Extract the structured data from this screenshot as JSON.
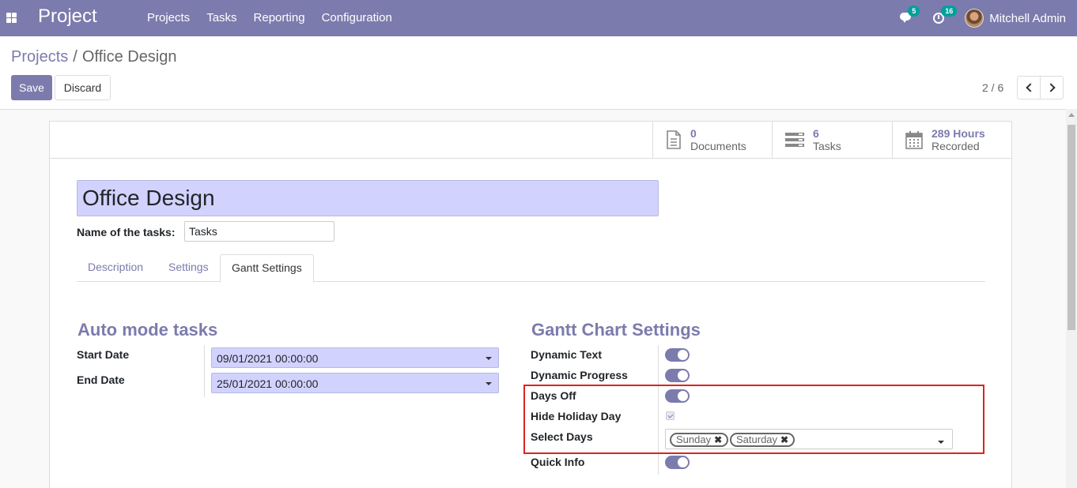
{
  "navbar": {
    "brand": "Project",
    "menu": [
      "Projects",
      "Tasks",
      "Reporting",
      "Configuration"
    ],
    "messages_count": "5",
    "activities_count": "16",
    "user_name": "Mitchell Admin"
  },
  "breadcrumb": {
    "parent": "Projects",
    "separator": "/",
    "current": "Office Design"
  },
  "actions": {
    "save": "Save",
    "discard": "Discard"
  },
  "pager": {
    "value": "2 / 6"
  },
  "stats": [
    {
      "value": "0",
      "label": "Documents",
      "icon": "document-icon"
    },
    {
      "value": "6",
      "label": "Tasks",
      "icon": "tasks-icon"
    },
    {
      "value": "289 Hours",
      "label": "Recorded",
      "icon": "calendar-icon"
    }
  ],
  "project": {
    "name": "Office Design",
    "tasks_label": "Name of the tasks:",
    "tasks_value": "Tasks"
  },
  "tabs": [
    "Description",
    "Settings",
    "Gantt Settings"
  ],
  "auto_mode": {
    "title": "Auto mode tasks",
    "start_label": "Start Date",
    "start_value": "09/01/2021 00:00:00",
    "end_label": "End Date",
    "end_value": "25/01/2021 00:00:00"
  },
  "gantt": {
    "title": "Gantt Chart Settings",
    "dynamic_text": "Dynamic Text",
    "dynamic_progress": "Dynamic Progress",
    "days_off": "Days Off",
    "hide_holiday": "Hide Holiday Day",
    "select_days": "Select Days",
    "days": [
      "Sunday",
      "Saturday"
    ],
    "quick_info": "Quick Info"
  },
  "colors": {
    "brand": "#7c7bad",
    "badge": "#00a09d",
    "highlight": "#d9261c",
    "input_bg": "#d2d2ff"
  }
}
